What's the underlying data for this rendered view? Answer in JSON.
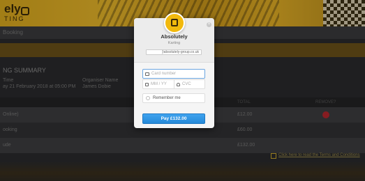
{
  "page": {
    "logo_text": "ely",
    "logo_sub": "TING",
    "subheader": "Booking",
    "summary_title": "NG SUMMARY",
    "meta": {
      "time_label": "Time",
      "time_value": "ay 21 February 2018 at 05:00 PM",
      "organiser_label": "Organiser Name",
      "organiser_value": "James Dobie"
    },
    "table": {
      "headers": [
        "TOTAL",
        "REMOVE?"
      ],
      "rows": [
        {
          "label": "Online)",
          "total": "£12.00"
        },
        {
          "label": "ooking",
          "total": "£60.00"
        },
        {
          "label": "ude",
          "total": "£132.00"
        }
      ]
    },
    "terms_link": "Click here to read the Terms and Conditions"
  },
  "modal": {
    "title": "Absolutely",
    "subtitle": "Karting",
    "email_suffix": "@absolutely-group.co.uk",
    "close_glyph": "×",
    "card_placeholder": "Card number",
    "expiry_placeholder": "MM / YY",
    "cvc_placeholder": "CVC",
    "remember_label": "Remember me",
    "pay_label": "Pay £132.00"
  },
  "colors": {
    "accent": "#f2b90d",
    "pay_button": "#2f95e6",
    "remove": "#b3262c"
  }
}
